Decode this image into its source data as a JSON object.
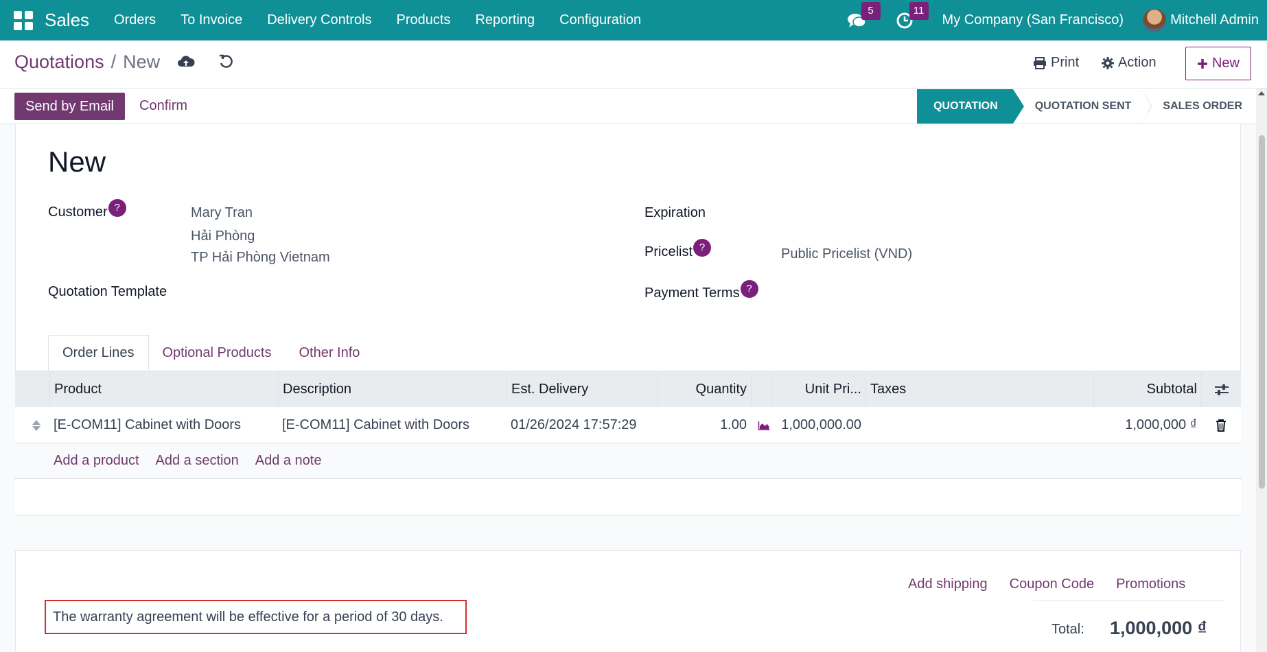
{
  "navbar": {
    "app_name": "Sales",
    "menu": [
      "Orders",
      "To Invoice",
      "Delivery Controls",
      "Products",
      "Reporting",
      "Configuration"
    ],
    "messages_count": "5",
    "activities_count": "11",
    "company": "My Company (San Francisco)",
    "user": "Mitchell Admin"
  },
  "control": {
    "breadcrumb_parent": "Quotations",
    "breadcrumb_separator": "/",
    "breadcrumb_current": "New",
    "print_label": "Print",
    "action_label": "Action",
    "new_label": "New"
  },
  "statusbar": {
    "send_email_label": "Send by Email",
    "confirm_label": "Confirm",
    "stages": [
      "QUOTATION",
      "QUOTATION SENT",
      "SALES ORDER"
    ],
    "active_stage": "QUOTATION"
  },
  "form": {
    "title": "New",
    "customer_label": "Customer",
    "customer_name": "Mary Tran",
    "customer_address_1": "Hải Phòng",
    "customer_address_2": "TP Hải Phòng Vietnam",
    "quotation_template_label": "Quotation Template",
    "expiration_label": "Expiration",
    "pricelist_label": "Pricelist",
    "pricelist_value": "Public Pricelist (VND)",
    "payment_terms_label": "Payment Terms",
    "help_mark": "?"
  },
  "tabs": [
    "Order Lines",
    "Optional Products",
    "Other Info"
  ],
  "table": {
    "columns": {
      "product": "Product",
      "description": "Description",
      "est_delivery": "Est. Delivery",
      "quantity": "Quantity",
      "unit_price": "Unit Pri...",
      "taxes": "Taxes",
      "subtotal": "Subtotal"
    },
    "rows": [
      {
        "product": "[E-COM11] Cabinet with Doors",
        "description": "[E-COM11] Cabinet with Doors",
        "est_delivery": "01/26/2024 17:57:29",
        "quantity": "1.00",
        "unit_price": "1,000,000.00",
        "taxes": "",
        "subtotal": "1,000,000 ₫"
      }
    ],
    "add_product": "Add a product",
    "add_section": "Add a section",
    "add_note": "Add a note"
  },
  "footer": {
    "add_shipping": "Add shipping",
    "coupon_code": "Coupon Code",
    "promotions": "Promotions",
    "total_label": "Total:",
    "total_value": "1,000,000 ₫",
    "terms_note": "The warranty agreement will be effective for a period of 30 days."
  },
  "colors": {
    "navbar": "#0f8f96",
    "primary": "#71396f",
    "badge": "#7a1f7a",
    "highlight_border": "#d32f2f"
  },
  "icons": [
    "apps-grid-icon",
    "chat-icon",
    "clock-icon",
    "cloud-upload-icon",
    "undo-icon",
    "print-icon",
    "gear-icon",
    "plus-icon",
    "drag-handle-icon",
    "chart-area-icon",
    "trash-icon",
    "column-settings-icon"
  ]
}
